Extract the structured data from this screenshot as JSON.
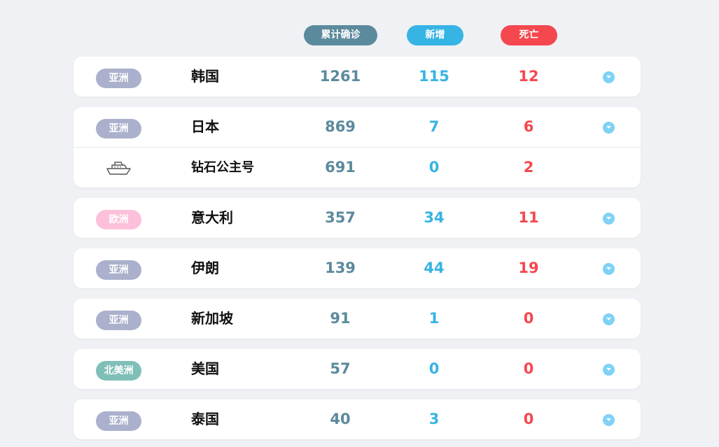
{
  "headers": {
    "total": "累计确诊",
    "new": "新增",
    "death": "死亡"
  },
  "colors": {
    "total": "#5b8a9c",
    "new": "#36b4e4",
    "death": "#f5474e",
    "asia_tag": "#abb1cc",
    "europe_tag": "#fcc0db",
    "north_america_tag": "#7fbfb7",
    "expand_icon": "#7fd2f5"
  },
  "rows": [
    {
      "region": "亚洲",
      "country": "韩国",
      "total": "1261",
      "new": "115",
      "death": "12"
    },
    {
      "region": "亚洲",
      "country": "日本",
      "total": "869",
      "new": "7",
      "death": "6",
      "sub": {
        "icon": "ship-icon",
        "name": "钻石公主号",
        "total": "691",
        "new": "0",
        "death": "2"
      }
    },
    {
      "region": "欧洲",
      "country": "意大利",
      "total": "357",
      "new": "34",
      "death": "11"
    },
    {
      "region": "亚洲",
      "country": "伊朗",
      "total": "139",
      "new": "44",
      "death": "19"
    },
    {
      "region": "亚洲",
      "country": "新加坡",
      "total": "91",
      "new": "1",
      "death": "0"
    },
    {
      "region": "北美洲",
      "country": "美国",
      "total": "57",
      "new": "0",
      "death": "0"
    },
    {
      "region": "亚洲",
      "country": "泰国",
      "total": "40",
      "new": "3",
      "death": "0"
    }
  ]
}
